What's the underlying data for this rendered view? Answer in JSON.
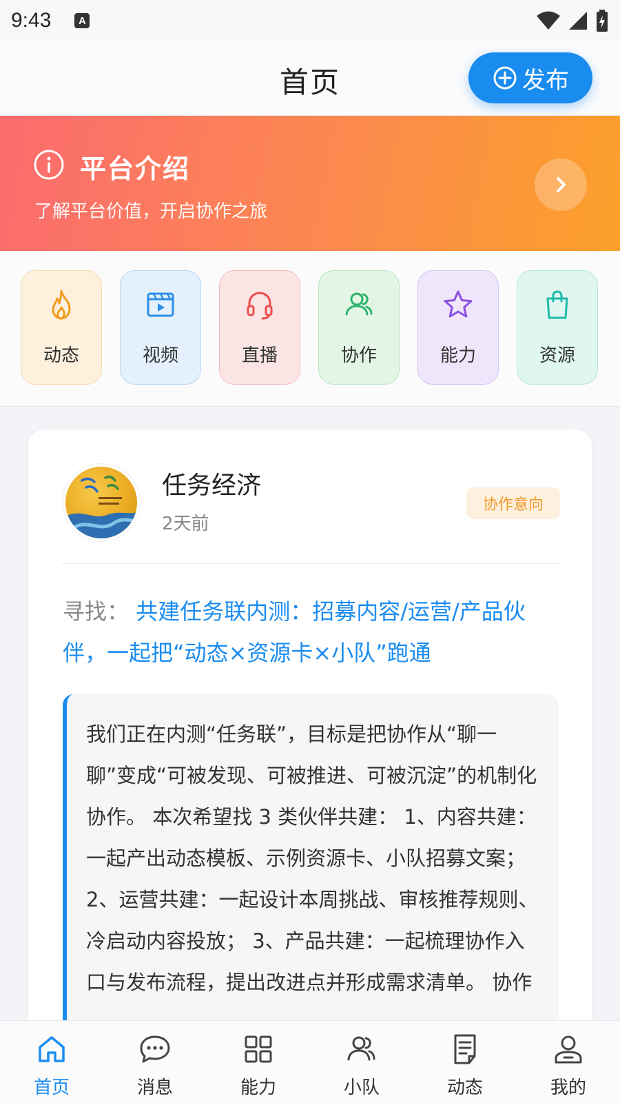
{
  "status_bar": {
    "time": "9:43",
    "notification_letter": "A"
  },
  "header": {
    "title": "首页",
    "publish_label": "发布"
  },
  "banner": {
    "title": "平台介绍",
    "subtitle": "了解平台价值，开启协作之旅"
  },
  "quick_entries": [
    {
      "label": "动态",
      "icon": "flame-icon",
      "color": "#f29b1e",
      "bg": "#fdf1de"
    },
    {
      "label": "视频",
      "icon": "video-icon",
      "color": "#2a8ee8",
      "bg": "#e4f0fb"
    },
    {
      "label": "直播",
      "icon": "headphones-icon",
      "color": "#ef4c4c",
      "bg": "#fbe4e4"
    },
    {
      "label": "协作",
      "icon": "users-icon",
      "color": "#2fb36a",
      "bg": "#e3f6e6"
    },
    {
      "label": "能力",
      "icon": "star-icon",
      "color": "#8b4ee0",
      "bg": "#efe6fb"
    },
    {
      "label": "资源",
      "icon": "bag-icon",
      "color": "#1fb9a8",
      "bg": "#dff6f1"
    }
  ],
  "post": {
    "author": "任务经济",
    "time": "2天前",
    "badge": "协作意向",
    "heading_prefix": "寻找：",
    "heading_link": "共建任务联内测：招募内容/运营/产品伙伴，一起把“动态×资源卡×小队”跑通",
    "body": "我们正在内测“任务联”，目标是把协作从“聊一聊”变成“可被发现、可被推进、可被沉淀”的机制化协作。 本次希望找 3 类伙伴共建： 1、内容共建：一起产出动态模板、示例资源卡、小队招募文案； 2、运营共建：一起设计本周挑战、审核推荐规则、冷启动内容投放； 3、产品共建：一起梳理协作入口与发布流程，提出改进点并形成需求清单。 协作"
  },
  "bottom_nav": [
    {
      "label": "首页",
      "icon": "home-icon",
      "active": true
    },
    {
      "label": "消息",
      "icon": "chat-icon",
      "active": false
    },
    {
      "label": "能力",
      "icon": "grid-icon",
      "active": false
    },
    {
      "label": "小队",
      "icon": "team-icon",
      "active": false
    },
    {
      "label": "动态",
      "icon": "document-icon",
      "active": false
    },
    {
      "label": "我的",
      "icon": "profile-icon",
      "active": false
    }
  ],
  "colors": {
    "accent": "#1a8cf0",
    "badge_text": "#f09a2a"
  }
}
